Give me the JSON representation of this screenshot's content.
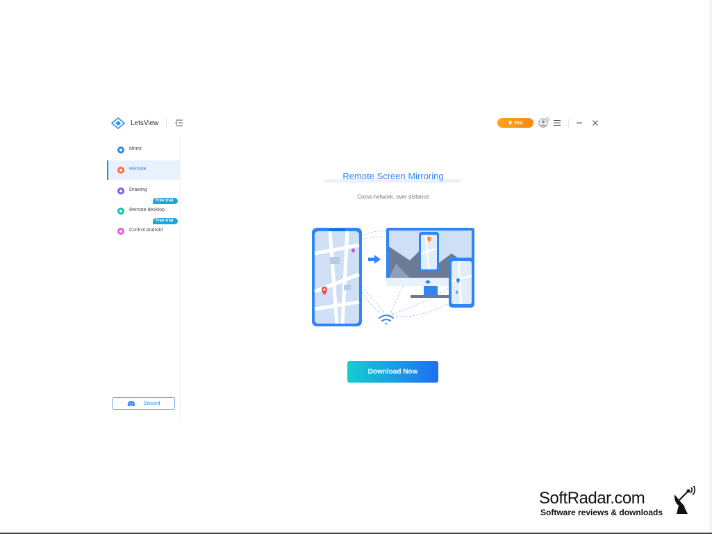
{
  "app": {
    "name": "LetsView"
  },
  "header": {
    "pro_label": "Pro"
  },
  "sidebar": {
    "items": [
      {
        "label": "Mirror",
        "color": "#2f86f0",
        "active": false
      },
      {
        "label": "Remote",
        "color": "#ff6a3d",
        "active": true
      },
      {
        "label": "Drawing",
        "color": "#7a5cf0",
        "active": false
      },
      {
        "label": "Remote desktop",
        "color": "#12c2a6",
        "active": false,
        "badge": "Free trial"
      },
      {
        "label": "Control Android",
        "color": "#e45ad6",
        "active": false,
        "badge": "Free trial"
      }
    ],
    "discord_label": "Discord"
  },
  "main": {
    "title": "Remote Screen Mirroring",
    "subtitle": "Cross-network, over distance",
    "download_label": "Download Now"
  },
  "watermark": {
    "title": "SoftRadar.com",
    "subtitle": "Software reviews & downloads"
  },
  "colors": {
    "accent": "#2f86f0",
    "pro": "#ffa320",
    "trial": "#1ca7d9",
    "download_start": "#14cdd2",
    "download_end": "#1f6ff2"
  }
}
